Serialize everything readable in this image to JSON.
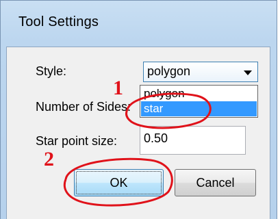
{
  "window": {
    "title": "Tool Settings"
  },
  "form": {
    "style_label": "Style:",
    "style_value": "polygon",
    "style_options": [
      "polygon",
      "star"
    ],
    "style_highlighted_option": "star",
    "sides_label": "Number of Sides:",
    "star_point_label": "Star point size:",
    "star_point_value": "0.50"
  },
  "buttons": {
    "ok_label": "OK",
    "cancel_label": "Cancel"
  },
  "annotations": {
    "step1": "1",
    "step2": "2",
    "color": "#e0121a"
  },
  "colors": {
    "highlight": "#3399ff",
    "title_bar": "#bcd6ef"
  }
}
